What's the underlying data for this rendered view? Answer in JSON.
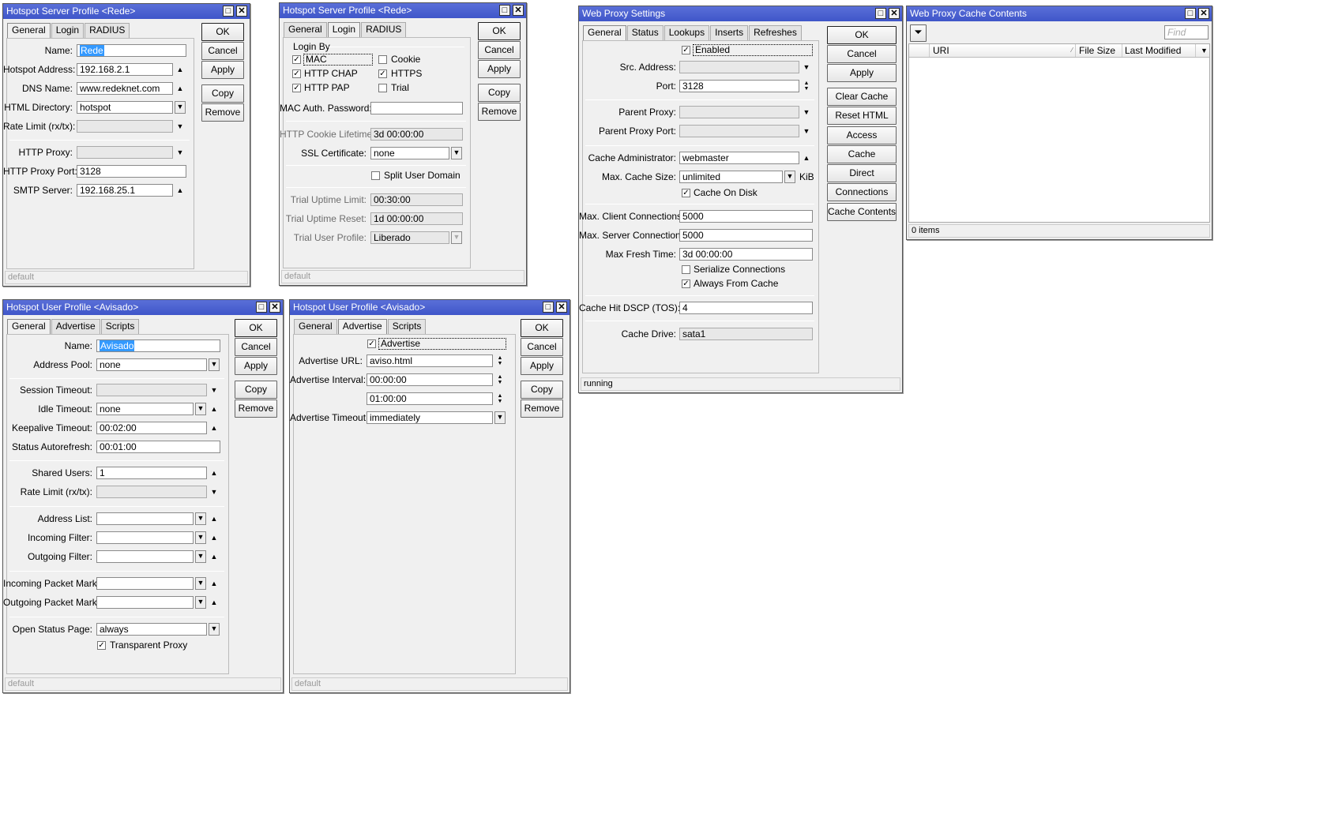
{
  "common": {
    "ok": "OK",
    "cancel": "Cancel",
    "apply": "Apply",
    "copy": "Copy",
    "remove": "Remove",
    "default_status": "default"
  },
  "w1": {
    "title": "Hotspot Server Profile <Rede>",
    "tabs": [
      "General",
      "Login",
      "RADIUS"
    ],
    "fields": [
      {
        "label": "Name:",
        "value": "Rede"
      },
      {
        "label": "Hotspot Address:",
        "value": "192.168.2.1"
      },
      {
        "label": "DNS Name:",
        "value": "www.redeknet.com"
      },
      {
        "label": "HTML Directory:",
        "value": "hotspot"
      },
      {
        "label": "Rate Limit (rx/tx):",
        "value": ""
      },
      {
        "label": "HTTP Proxy:",
        "value": ""
      },
      {
        "label": "HTTP Proxy Port:",
        "value": "3128"
      },
      {
        "label": "SMTP Server:",
        "value": "192.168.25.1"
      }
    ]
  },
  "w2": {
    "title": "Hotspot Server Profile <Rede>",
    "tabs": [
      "General",
      "Login",
      "RADIUS"
    ],
    "login_by": "Login By",
    "checks": [
      {
        "label": "MAC",
        "checked": true
      },
      {
        "label": "Cookie",
        "checked": false
      },
      {
        "label": "HTTP CHAP",
        "checked": true
      },
      {
        "label": "HTTPS",
        "checked": true
      },
      {
        "label": "HTTP PAP",
        "checked": true
      },
      {
        "label": "Trial",
        "checked": false
      }
    ],
    "fields": [
      {
        "label": "MAC Auth. Password:",
        "value": ""
      },
      {
        "label": "HTTP Cookie Lifetime:",
        "value": "3d 00:00:00"
      },
      {
        "label": "SSL Certificate:",
        "value": "none"
      },
      {
        "label": "Trial Uptime Limit:",
        "value": "00:30:00"
      },
      {
        "label": "Trial Uptime Reset:",
        "value": "1d 00:00:00"
      },
      {
        "label": "Trial User Profile:",
        "value": "Liberado"
      }
    ],
    "split_user_domain": "Split User Domain"
  },
  "w3": {
    "title": "Web Proxy Settings",
    "tabs": [
      "General",
      "Status",
      "Lookups",
      "Inserts",
      "Refreshes"
    ],
    "enabled": "Enabled",
    "fields": [
      {
        "label": "Src. Address:",
        "value": ""
      },
      {
        "label": "Port:",
        "value": "3128"
      },
      {
        "label": "Parent Proxy:",
        "value": ""
      },
      {
        "label": "Parent Proxy Port:",
        "value": ""
      },
      {
        "label": "Cache Administrator:",
        "value": "webmaster"
      },
      {
        "label": "Max. Cache Size:",
        "value": "unlimited"
      },
      {
        "label": "Max. Client Connections:",
        "value": "5000"
      },
      {
        "label": "Max. Server Connections:",
        "value": "5000"
      },
      {
        "label": "Max Fresh Time:",
        "value": "3d 00:00:00"
      },
      {
        "label": "Cache Hit DSCP (TOS):",
        "value": "4"
      },
      {
        "label": "Cache Drive:",
        "value": "sata1"
      }
    ],
    "kib": "KiB",
    "cache_on_disk": "Cache On Disk",
    "serialize": "Serialize Connections",
    "always_from_cache": "Always From Cache",
    "buttons": [
      "OK",
      "Cancel",
      "Apply",
      "Clear Cache",
      "Reset HTML",
      "Access",
      "Cache",
      "Direct",
      "Connections",
      "Cache Contents"
    ],
    "status": "running"
  },
  "w4": {
    "title": "Web Proxy Cache Contents",
    "find_placeholder": "Find",
    "columns": [
      "URI",
      "File Size",
      "Last Modified"
    ],
    "status": "0 items"
  },
  "w5": {
    "title": "Hotspot User Profile <Avisado>",
    "tabs": [
      "General",
      "Advertise",
      "Scripts"
    ],
    "fields": [
      {
        "label": "Name:",
        "value": "Avisado"
      },
      {
        "label": "Address Pool:",
        "value": "none"
      },
      {
        "label": "Session Timeout:",
        "value": ""
      },
      {
        "label": "Idle Timeout:",
        "value": "none"
      },
      {
        "label": "Keepalive Timeout:",
        "value": "00:02:00"
      },
      {
        "label": "Status Autorefresh:",
        "value": "00:01:00"
      },
      {
        "label": "Shared Users:",
        "value": "1"
      },
      {
        "label": "Rate Limit (rx/tx):",
        "value": ""
      },
      {
        "label": "Address List:",
        "value": ""
      },
      {
        "label": "Incoming Filter:",
        "value": ""
      },
      {
        "label": "Outgoing Filter:",
        "value": ""
      },
      {
        "label": "Incoming Packet Mark:",
        "value": ""
      },
      {
        "label": "Outgoing Packet Mark:",
        "value": ""
      },
      {
        "label": "Open Status Page:",
        "value": "always"
      }
    ],
    "transparent_proxy": "Transparent Proxy"
  },
  "w6": {
    "title": "Hotspot User Profile <Avisado>",
    "tabs": [
      "General",
      "Advertise",
      "Scripts"
    ],
    "advertise": "Advertise",
    "fields": [
      {
        "label": "Advertise URL:",
        "value": "aviso.html"
      },
      {
        "label": "Advertise Interval:",
        "value": "00:00:00"
      },
      {
        "label": "",
        "value": "01:00:00"
      },
      {
        "label": "Advertise Timeout:",
        "value": "immediately"
      }
    ]
  }
}
